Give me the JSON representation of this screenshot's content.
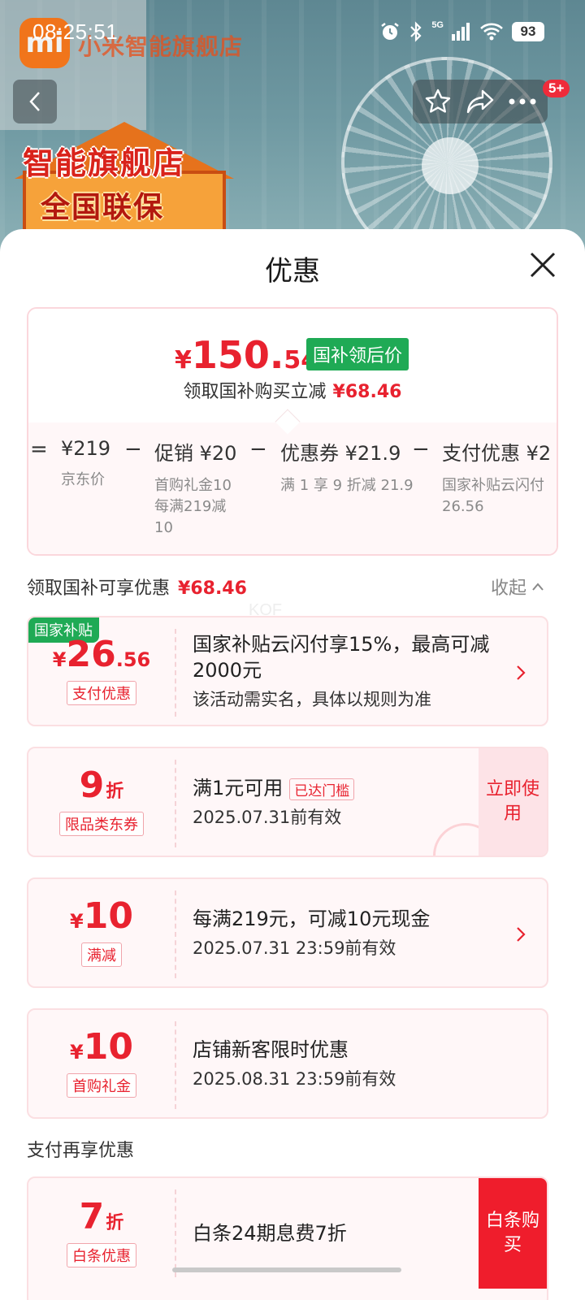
{
  "status_bar": {
    "time": "08:25:51",
    "network": "5G",
    "battery": "93"
  },
  "store": {
    "name": "小米智能旗舰店",
    "logo_text": "mi",
    "badge_line1": "智能旗舰店",
    "badge_line2": "全国联保"
  },
  "nav": {
    "notification_count": "5+"
  },
  "sheet": {
    "title": "优惠",
    "final_price": {
      "currency": "¥",
      "integer": "150.",
      "decimal": "54",
      "tag": "国补领后价"
    },
    "saved_text": "领取国补购买立减",
    "saved_amount": "¥68.46",
    "breakdown": [
      {
        "op": "=",
        "main": "¥219",
        "sub": [
          "京东价"
        ]
      },
      {
        "op": "−",
        "main": "促销 ¥20",
        "sub": [
          "首购礼金10",
          "每满219减",
          "10"
        ]
      },
      {
        "op": "−",
        "main": "优惠券 ¥21.9",
        "sub": [
          "满 1 享 9 折减 21.9"
        ]
      },
      {
        "op": "−",
        "main": "支付优惠 ¥2",
        "sub": [
          "国家补贴云闪付",
          "26.56"
        ]
      }
    ],
    "section_govt": {
      "label": "领取国补可享优惠",
      "amount": "¥68.46",
      "collapse": "收起"
    },
    "watermark": "KOF",
    "coupons": [
      {
        "corner_tag": "国家补贴",
        "yen": "¥",
        "num": "26",
        "dec": ".56",
        "type": "支付优惠",
        "title": "国家补贴云闪付享15%，最高可减2000元",
        "desc": "该活动需实名，具体以规则为准"
      },
      {
        "num": "9",
        "zhe": "折",
        "type": "限品类东券",
        "title": "满1元可用",
        "reach_tag": "已达门槛",
        "desc": "2025.07.31前有效",
        "button": "立即使用"
      },
      {
        "yen": "¥",
        "num": "10",
        "type": "满减",
        "title": "每满219元，可减10元现金",
        "desc": "2025.07.31 23:59前有效"
      },
      {
        "yen": "¥",
        "num": "10",
        "type": "首购礼金",
        "title": "店铺新客限时优惠",
        "desc": "2025.08.31 23:59前有效"
      }
    ],
    "section_pay": {
      "label": "支付再享优惠"
    },
    "pay_coupon": {
      "num": "7",
      "zhe": "折",
      "type": "白条优惠",
      "title": "白条24期息费7折",
      "button": "白条购买"
    }
  },
  "colors": {
    "accent_red": "#e8222f",
    "green_tag": "#1faa55",
    "card_bg": "#fff7f8"
  }
}
